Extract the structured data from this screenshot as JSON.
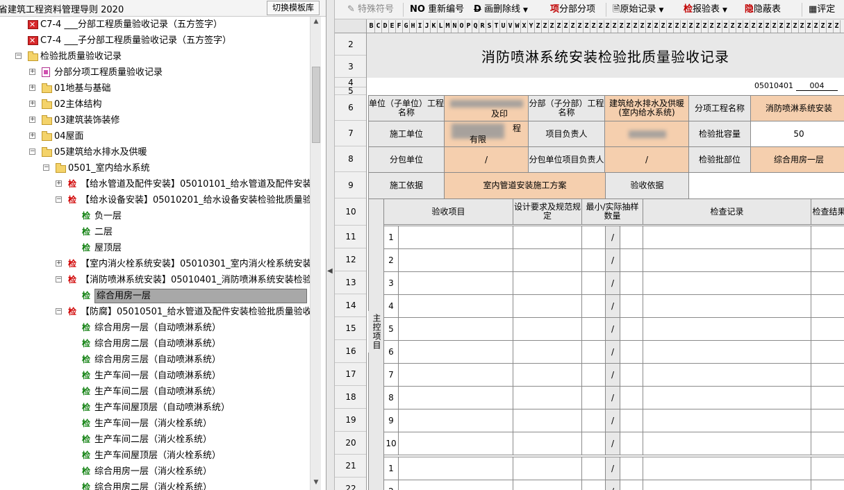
{
  "left_header": {
    "title": "省建筑工程资料管理导则 2020",
    "switch_btn": "切换模板库"
  },
  "tree": [
    {
      "icon": "x",
      "indent": 40,
      "label": "C7-4 ___分部工程质量验收记录（五方签字）"
    },
    {
      "icon": "x",
      "indent": 40,
      "label": "C7-4 ___子分部工程质量验收记录（五方签字）"
    },
    {
      "icon": "fold",
      "indent": 40,
      "exp": "-",
      "label": "检验批质量验收记录"
    },
    {
      "icon": "doc",
      "indent": 60,
      "exp": "+",
      "label": "分部分项工程质量验收记录"
    },
    {
      "icon": "fold",
      "indent": 60,
      "exp": "+",
      "label": "01地基与基础"
    },
    {
      "icon": "fold",
      "indent": 60,
      "exp": "+",
      "label": "02主体结构"
    },
    {
      "icon": "fold",
      "indent": 60,
      "exp": "+",
      "label": "03建筑装饰装修"
    },
    {
      "icon": "fold",
      "indent": 60,
      "exp": "+",
      "label": "04屋面"
    },
    {
      "icon": "fold",
      "indent": 60,
      "exp": "-",
      "label": "05建筑给水排水及供暖"
    },
    {
      "icon": "fold",
      "indent": 80,
      "exp": "-",
      "label": "0501_室内给水系统"
    },
    {
      "icon": "jr",
      "indent": 98,
      "exp": "+",
      "label": "【给水管道及配件安装】05010101_给水管道及配件安装"
    },
    {
      "icon": "jr",
      "indent": 98,
      "exp": "-",
      "label": "【给水设备安装】05010201_给水设备安装检验批质量验"
    },
    {
      "icon": "jg",
      "indent": 118,
      "label": "负一层"
    },
    {
      "icon": "jg",
      "indent": 118,
      "label": "二层"
    },
    {
      "icon": "jg",
      "indent": 118,
      "label": "屋顶层"
    },
    {
      "icon": "jr",
      "indent": 98,
      "exp": "+",
      "label": "【室内消火栓系统安装】05010301_室内消火栓系统安装"
    },
    {
      "icon": "jr",
      "indent": 98,
      "exp": "-",
      "label": "【消防喷淋系统安装】05010401_消防喷淋系统安装检验"
    },
    {
      "icon": "jg",
      "indent": 118,
      "label": "综合用房一层",
      "selected": true
    },
    {
      "icon": "jr",
      "indent": 98,
      "exp": "-",
      "label": "【防腐】05010501_给水管道及配件安装检验批质量验收"
    },
    {
      "icon": "jg",
      "indent": 118,
      "label": "综合用房一层（自动喷淋系统）"
    },
    {
      "icon": "jg",
      "indent": 118,
      "label": "综合用房二层（自动喷淋系统）"
    },
    {
      "icon": "jg",
      "indent": 118,
      "label": "综合用房三层（自动喷淋系统）"
    },
    {
      "icon": "jg",
      "indent": 118,
      "label": "生产车间一层（自动喷淋系统）"
    },
    {
      "icon": "jg",
      "indent": 118,
      "label": "生产车间二层（自动喷淋系统）"
    },
    {
      "icon": "jg",
      "indent": 118,
      "label": "生产车间屋顶层（自动喷淋系统）"
    },
    {
      "icon": "jg",
      "indent": 118,
      "label": "生产车间一层（消火栓系统）"
    },
    {
      "icon": "jg",
      "indent": 118,
      "label": "生产车间二层（消火栓系统）"
    },
    {
      "icon": "jg",
      "indent": 118,
      "label": "生产车间屋顶层（消火栓系统）"
    },
    {
      "icon": "jg",
      "indent": 118,
      "label": "综合用房一层（消火栓系统）"
    },
    {
      "icon": "jg",
      "indent": 118,
      "label": "综合用房二层（消火栓系统）"
    }
  ],
  "jian_char": "检",
  "toolbar": {
    "special": "特殊符号",
    "renumber_prefix": "NO",
    "renumber": "重新编号",
    "strike_prefix": "D",
    "strike": "画删除线",
    "item_prefix": "项",
    "item": "分部分项",
    "orig": "原始记录",
    "check_prefix": "检",
    "check": "报验表",
    "hide_prefix": "隐",
    "hide": "隐蔽表",
    "rate": "评定"
  },
  "columns": "BCDEFGHIJKLMNOPQRSTUVWXYZ",
  "row_numbers": [
    "2",
    "3",
    "4",
    "5",
    "6",
    "7",
    "8",
    "9",
    "10",
    "11",
    "12",
    "13",
    "14",
    "15",
    "16",
    "17",
    "18",
    "19",
    "20",
    "21",
    "22"
  ],
  "form": {
    "title": "消防喷淋系统安装检验批质量验收记录",
    "code": "05010401",
    "code_num": "004",
    "unit_label": "单位（子单位）工程名称",
    "unit_value_suffix": "及印",
    "sub_label": "分部（子分部）工程名称",
    "sub_value": "建筑给水排水及供暖(室内给水系统)",
    "item_label": "分项工程名称",
    "item_value": "消防喷淋系统安装",
    "constructor_label": "施工单位",
    "constructor_value_a": "程",
    "constructor_value_b": "有限",
    "pm_label": "项目负责人",
    "capacity_label": "检验批容量",
    "capacity_value": "50",
    "subcon_label": "分包单位",
    "subcon_value": "/",
    "subpm_label": "分包单位项目负责人",
    "subpm_value": "/",
    "part_label": "检验批部位",
    "part_value": "综合用房一层",
    "basis_label": "施工依据",
    "basis_value": "室内管道安装施工方案",
    "accept_label": "验收依据",
    "h_item": "验收项目",
    "h_design": "设计要求及规范规定",
    "h_sample": "最小/实际抽样数量",
    "h_record": "检查记录",
    "h_result": "检查结果",
    "main_label": "主控项目",
    "slash": "/",
    "row_ids": [
      "1",
      "2",
      "3",
      "4",
      "5",
      "6",
      "7",
      "8",
      "9",
      "10"
    ],
    "row_ids2": [
      "1",
      "2"
    ]
  }
}
